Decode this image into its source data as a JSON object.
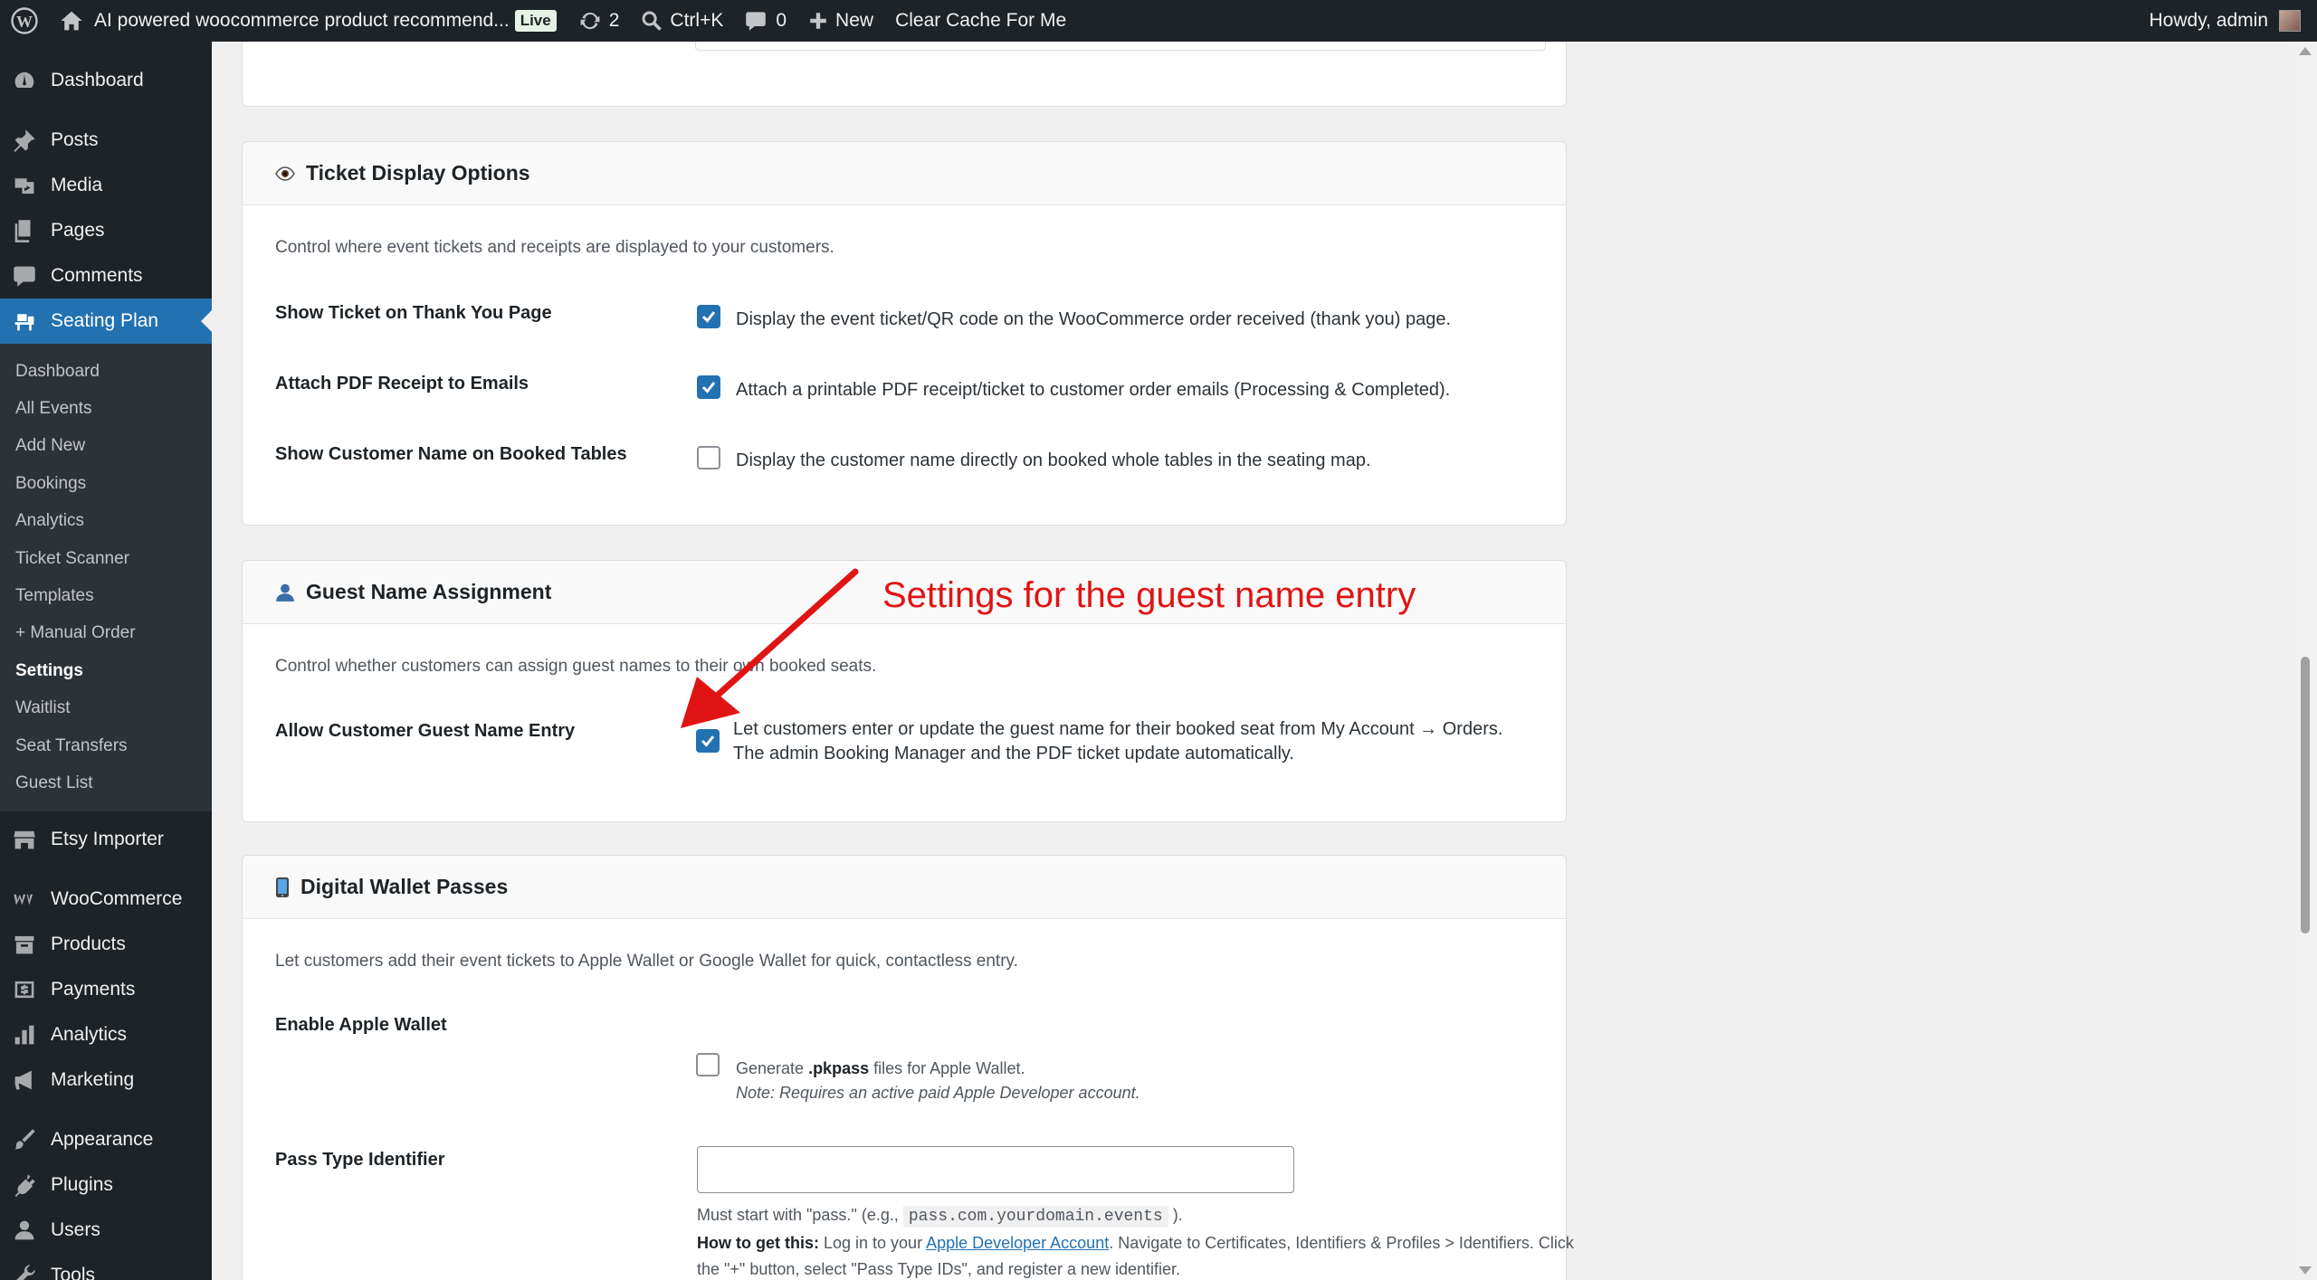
{
  "adminbar": {
    "site_title": "AI powered woocommerce product recommend...",
    "live_badge": "Live",
    "updates_count": "2",
    "search_shortcut": "Ctrl+K",
    "comments_count": "0",
    "new_label": "New",
    "clear_cache": "Clear Cache For Me",
    "howdy": "Howdy, admin"
  },
  "sidebar": {
    "top_items": [
      {
        "label": "Dashboard",
        "icon": "dashboard-icon"
      },
      {
        "label": "Posts",
        "icon": "pin-icon"
      },
      {
        "label": "Media",
        "icon": "media-icon"
      },
      {
        "label": "Pages",
        "icon": "pages-icon"
      },
      {
        "label": "Comments",
        "icon": "comment-icon"
      },
      {
        "label": "Seating Plan",
        "icon": "seating-icon"
      }
    ],
    "submenu": [
      "Dashboard",
      "All Events",
      "Add New",
      "Bookings",
      "Analytics",
      "Ticket Scanner",
      "Templates",
      "+ Manual Order",
      "Settings",
      "Waitlist",
      "Seat Transfers",
      "Guest List"
    ],
    "active_submenu": "Settings",
    "bottom_items": [
      {
        "label": "Etsy Importer",
        "icon": "store-icon"
      },
      {
        "label": "WooCommerce",
        "icon": "woo-icon"
      },
      {
        "label": "Products",
        "icon": "archive-icon"
      },
      {
        "label": "Payments",
        "icon": "payments-icon"
      },
      {
        "label": "Analytics",
        "icon": "bar-chart-icon"
      },
      {
        "label": "Marketing",
        "icon": "megaphone-icon"
      },
      {
        "label": "Appearance",
        "icon": "brush-icon"
      },
      {
        "label": "Plugins",
        "icon": "plugin-icon"
      },
      {
        "label": "Users",
        "icon": "user-icon"
      },
      {
        "label": "Tools",
        "icon": "wrench-icon"
      }
    ]
  },
  "ticket_display": {
    "title": "Ticket Display Options",
    "description": "Control where event tickets and receipts are displayed to your customers.",
    "rows": [
      {
        "label": "Show Ticket on Thank You Page",
        "text": "Display the event ticket/QR code on the WooCommerce order received (thank you) page.",
        "checked": true
      },
      {
        "label": "Attach PDF Receipt to Emails",
        "text": "Attach a printable PDF receipt/ticket to customer order emails (Processing & Completed).",
        "checked": true
      },
      {
        "label": "Show Customer Name on Booked Tables",
        "text": "Display the customer name directly on booked whole tables in the seating map.",
        "checked": false
      }
    ]
  },
  "guest_name": {
    "title": "Guest Name Assignment",
    "description": "Control whether customers can assign guest names to their own booked seats.",
    "label": "Allow Customer Guest Name Entry",
    "text_line1": "Let customers enter or update the guest name for their booked seat from My Account → Orders.",
    "text_line2": "The admin Booking Manager and the PDF ticket update automatically.",
    "checked": true
  },
  "annotation": {
    "text": "Settings for the guest name entry",
    "color": "#e01414"
  },
  "wallet": {
    "title": "Digital Wallet Passes",
    "description": "Let customers add their event tickets to Apple Wallet or Google Wallet for quick, contactless entry.",
    "apple_label": "Enable Apple Wallet",
    "apple_text_pre": "Generate ",
    "apple_text_bold": ".pkpass",
    "apple_text_post": " files for Apple Wallet.",
    "apple_note": "Note: Requires an active paid Apple Developer account.",
    "apple_checked": false,
    "pass_label": "Pass Type Identifier",
    "pass_value": "",
    "helper_pre": "Must start with \"pass.\" (e.g., ",
    "helper_code": "pass.com.yourdomain.events",
    "helper_post": " ).",
    "howto_bold": "How to get this:",
    "howto_pre": " Log in to your ",
    "howto_link": "Apple Developer Account",
    "howto_post": ". Navigate to Certificates, Identifiers & Profiles > Identifiers. Click the \"+\" button, select \"Pass Type IDs\", and register a new identifier."
  },
  "colors": {
    "admin_bg": "#1d2327",
    "accent": "#2271b1",
    "annotation": "#e01414"
  }
}
